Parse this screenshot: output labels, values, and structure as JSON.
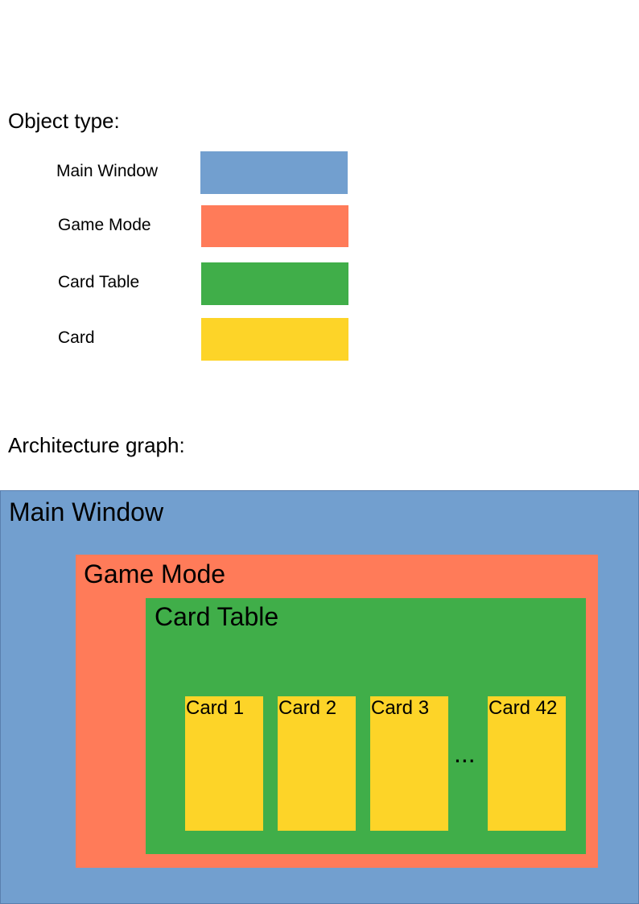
{
  "colors": {
    "main_window": "#729fcf",
    "game_mode": "#ff7b59",
    "card_table": "#40ae49",
    "card": "#fdd428",
    "text": "#000000"
  },
  "legend": {
    "heading": "Object type:",
    "items": [
      {
        "label": "Main Window",
        "color_key": "main_window"
      },
      {
        "label": "Game Mode",
        "color_key": "game_mode"
      },
      {
        "label": "Card Table",
        "color_key": "card_table"
      },
      {
        "label": "Card",
        "color_key": "card"
      }
    ]
  },
  "architecture": {
    "heading": "Architecture graph:",
    "main_window": {
      "title": "Main Window"
    },
    "game_mode": {
      "title": "Game Mode"
    },
    "card_table": {
      "title": "Card Table"
    },
    "cards": [
      {
        "label": "Card 1"
      },
      {
        "label": "Card 2"
      },
      {
        "label": "Card 3"
      },
      {
        "label": "Card 42"
      }
    ],
    "ellipsis": "..."
  }
}
